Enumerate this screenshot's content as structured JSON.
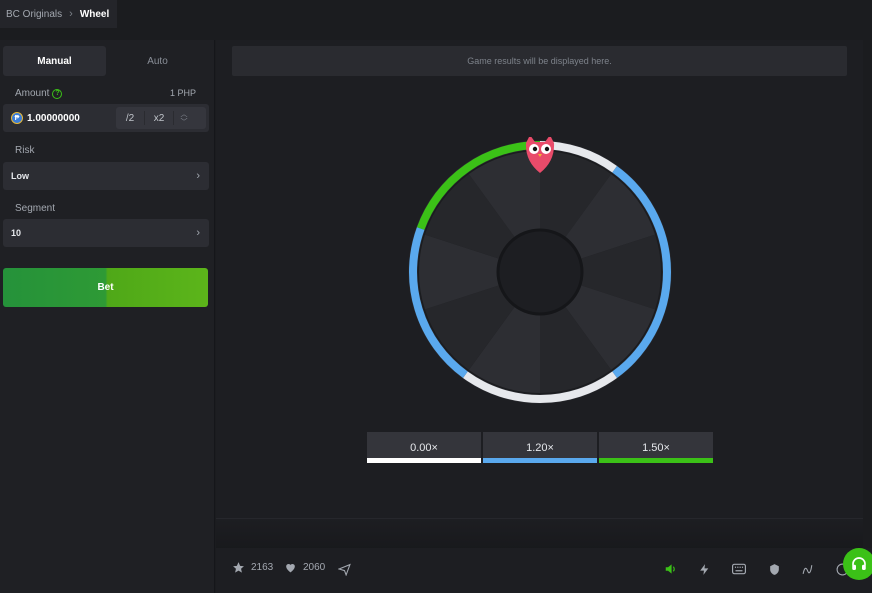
{
  "breadcrumb": {
    "parent": "BC Originals",
    "current": "Wheel"
  },
  "tabs": [
    {
      "label": "Manual",
      "active": true
    },
    {
      "label": "Auto",
      "active": false
    }
  ],
  "amount": {
    "label": "Amount",
    "unit": "1 PHP",
    "value": "1.00000000",
    "half_label": "/2",
    "double_label": "x2",
    "coin_symbol": "₱"
  },
  "risk": {
    "label": "Risk",
    "value": "Low"
  },
  "segment": {
    "label": "Segment",
    "value": "10"
  },
  "bet_button": {
    "label": "Bet"
  },
  "results_placeholder": "Game results will be displayed here.",
  "wheel": {
    "segments": 10,
    "colors": {
      "white": "#e6e8ec",
      "blue": "#5aa9ee",
      "green": "#3bc117"
    }
  },
  "multipliers": [
    {
      "label": "0.00×",
      "color": "#ffffff"
    },
    {
      "label": "1.20×",
      "color": "#5aa9ee"
    },
    {
      "label": "1.50×",
      "color": "#3bc117"
    }
  ],
  "footer": {
    "favorites": "2163",
    "likes": "2060"
  },
  "icons": [
    "star-icon",
    "heart-icon",
    "share-icon",
    "sound-icon",
    "lightning-icon",
    "keyboard-icon",
    "fairness-icon",
    "chart-icon",
    "info-icon",
    "headset-icon"
  ]
}
